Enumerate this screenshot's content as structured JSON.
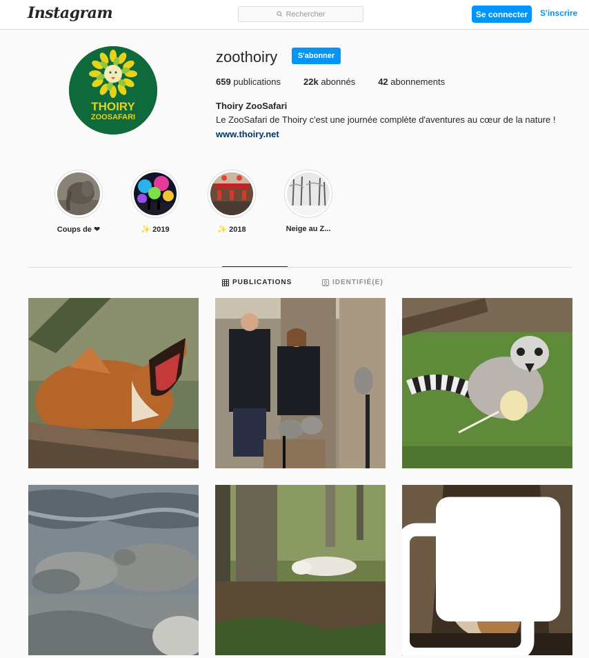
{
  "topbar": {
    "logo_text": "Instagram",
    "search_placeholder": "Rechercher",
    "login_label": "Se connecter",
    "signup_label": "S'inscrire"
  },
  "profile": {
    "avatar_text_line1": "THOIRY",
    "avatar_text_line2": "ZOOSAFARI",
    "username": "zoothoiry",
    "follow_label": "S'abonner",
    "stats": {
      "posts_count": "659",
      "posts_label": "publications",
      "followers_count": "22k",
      "followers_label": "abonnés",
      "following_count": "42",
      "following_label": "abonnements"
    },
    "full_name": "Thoiry ZooSafari",
    "bio": "Le ZooSafari de Thoiry c'est une journée complète d'aventures au cœur de la nature !",
    "website": "www.thoiry.net"
  },
  "highlights": [
    {
      "label": "Coups de ❤"
    },
    {
      "label": "✨ 2019"
    },
    {
      "label": "✨ 2018"
    },
    {
      "label": "Neige au Z..."
    }
  ],
  "tabs": {
    "publications": "PUBLICATIONS",
    "tagged": "IDENTIFIÉ(E)"
  },
  "posts": [
    {
      "subject": "maned wolf yawning"
    },
    {
      "subject": "two keepers with lemurs"
    },
    {
      "subject": "ring-tailed lemur eating"
    },
    {
      "subject": "hippos in mud"
    },
    {
      "subject": "white wolf resting in forest"
    },
    {
      "subject": "barn owls in tree hollow",
      "multi": true
    }
  ],
  "colors": {
    "accent": "#0095f6",
    "avatar_bg": "#0f6a3b",
    "logo_yellow": "#e7d21c"
  }
}
